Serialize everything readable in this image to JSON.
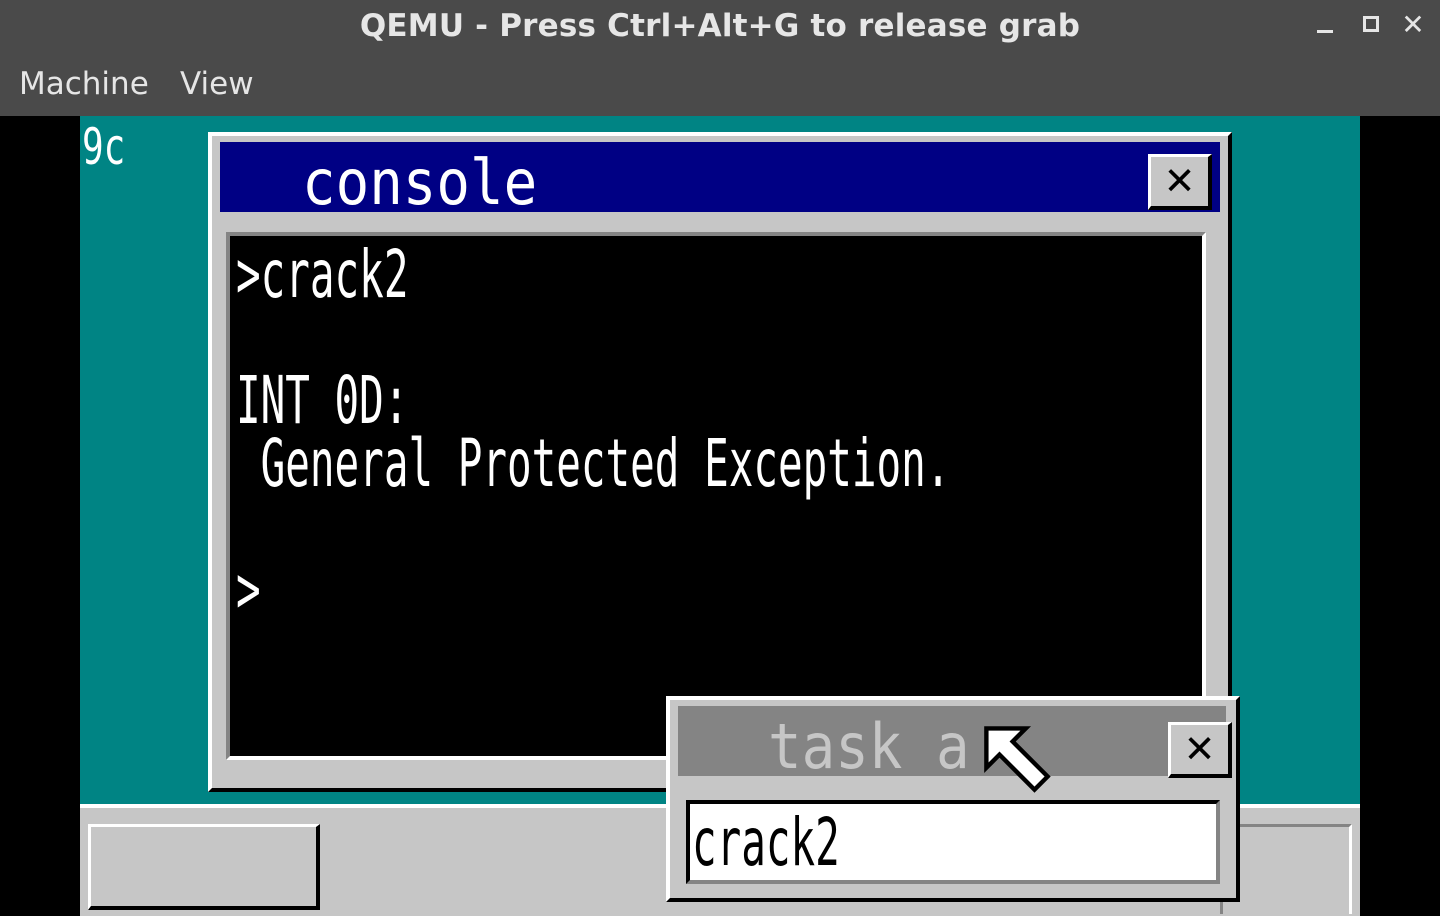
{
  "host": {
    "window_title": "QEMU - Press Ctrl+Alt+G to release grab",
    "controls": {
      "minimize_icon": "minimize-icon",
      "maximize_icon": "maximize-icon",
      "close_glyph": "✕"
    },
    "menu": [
      "Machine",
      "View"
    ]
  },
  "guest": {
    "background_color": "#008484",
    "background_text": "9c",
    "console_window": {
      "title": "console",
      "close_glyph": "✕",
      "lines": [
        ">crack2",
        "",
        "INT 0D:",
        " General Protected Exception.",
        "",
        ">"
      ]
    },
    "task_a_window": {
      "title": "task_a",
      "close_glyph": "✕",
      "textbox_value": "crack2"
    },
    "cursor_icon": "mouse-pointer-icon"
  },
  "colors": {
    "title_active": "#000084",
    "title_inactive": "#848484",
    "window_face": "#c6c6c6",
    "desktop": "#008484"
  }
}
